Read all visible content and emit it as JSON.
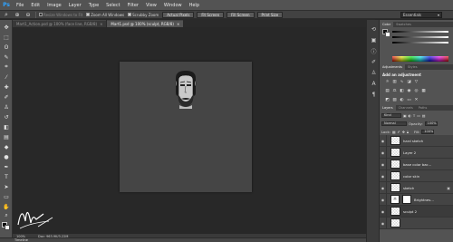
{
  "app": {
    "logo": "Ps"
  },
  "menu": [
    "File",
    "Edit",
    "Image",
    "Layer",
    "Type",
    "Select",
    "Filter",
    "View",
    "Window",
    "Help"
  ],
  "options": {
    "tool_icon": "zoom-icon",
    "resize_windows": "Resize Windows to Fit",
    "zoom_all": "Zoom All Windows",
    "scrubby": "Scrubby Zoom",
    "btn_actual": "Actual Pixels",
    "btn_fit": "Fit Screen",
    "btn_fill": "Fill Screen",
    "btn_print": "Print Size",
    "workspace": "Essentials"
  },
  "tabs": [
    {
      "label": "Mart1_Action.psd @ 100% (face line, RGB/8)",
      "active": false
    },
    {
      "label": "Mart1.psd @ 100% (sculpt, RGB/8)",
      "active": true
    }
  ],
  "status": {
    "zoom": "100%",
    "doc": "Doc: 963.9K/3.22M"
  },
  "timeline": {
    "label": "Timeline"
  },
  "panels": {
    "color_tabs": [
      "Color",
      "Swatches"
    ],
    "adj_tabs": [
      "Adjustments",
      "Styles"
    ],
    "adj_title": "Add an adjustment",
    "layer_tabs": [
      "Layers",
      "Channels",
      "Paths"
    ],
    "kind": "Kind",
    "blend": "Normal",
    "opacity_label": "Opacity:",
    "opacity": "100%",
    "lock_label": "Lock:",
    "fill_label": "Fill:",
    "fill": "100%"
  },
  "layers": [
    {
      "name": "hard sketch",
      "type": "pixel"
    },
    {
      "name": "Layer 2",
      "type": "pixel"
    },
    {
      "name": "base color bac...",
      "type": "pixel",
      "underline": true
    },
    {
      "name": "color skin",
      "type": "pixel"
    },
    {
      "name": "sketch",
      "type": "pixel"
    },
    {
      "name": "Brightnes...",
      "type": "adjustment"
    },
    {
      "name": "sculpt 2",
      "type": "pixel"
    },
    {
      "name": "",
      "type": "pixel"
    }
  ],
  "colors": {
    "accent": "#2fa3ff",
    "panel": "#535353",
    "bg": "#282828"
  }
}
